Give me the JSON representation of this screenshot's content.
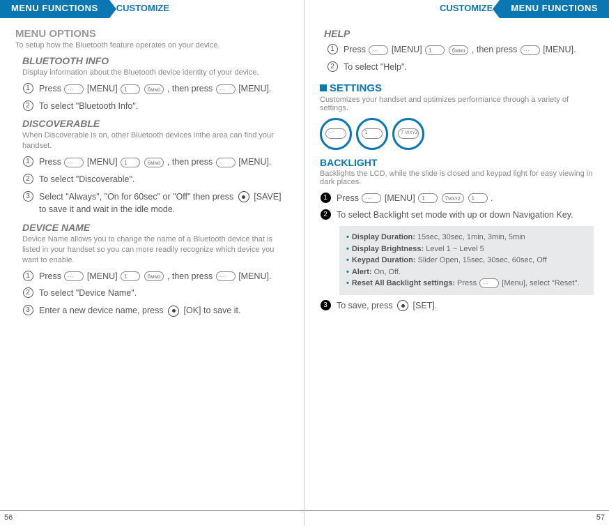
{
  "ribbon": {
    "menu_functions": "MENU FUNCTIONS",
    "customize": "CUSTOMIZE"
  },
  "left": {
    "menu_options": "MENU OPTIONS",
    "menu_options_sub": "To setup how the Bluetooth feature operates on your device.",
    "bt_info": "BLUETOOTH INFO",
    "bt_info_sub": "Display information about the Bluetooth device identity of your device.",
    "bt_s1": "Press [MENU] , then press [MENU].",
    "bt_s1_a": "Press ",
    "bt_s1_b": " [MENU] ",
    "bt_s1_c": " , then press ",
    "bt_s1_d": " [MENU].",
    "bt_s2": "To select \"Bluetooth Info\".",
    "disc": "DISCOVERABLE",
    "disc_sub": "When Discoverable is on, other Bluetooth devices inthe area can find your handset.",
    "disc_s1": "Press [MENU] , then press [MENU].",
    "disc_s2": "To select \"Discoverable\".",
    "disc_s3a": "Select \"Always\", \"On for 60sec\" or \"Off\" then press ",
    "disc_s3b": " [SAVE] to save it and wait in the idle mode.",
    "dn": "DEVICE NAME",
    "dn_sub": "Device Name allows you to change the name of a Bluetooth device that is listed in your handset so you can more readily recognize which device you want to enable.",
    "dn_s1": "Press [MENU] , then press [MENU].",
    "dn_s2": "To select \"Device Name\".",
    "dn_s3a": "Enter a new device name, press ",
    "dn_s3b": " [OK] to save it.",
    "page": "56"
  },
  "right": {
    "help": "HELP",
    "help_s1a": "Press ",
    "help_s1b": " [MENU] ",
    "help_s1c": " , then press ",
    "help_s1d": " [MENU].",
    "help_s2": "To select \"Help\".",
    "settings": "SETTINGS",
    "settings_sub": "Customizes your handset and optimizes performance through a variety of settings.",
    "key1": "···",
    "key2": "1",
    "key3": "7 ᴡxʏz",
    "backlight": "BACKLIGHT",
    "backlight_sub": "Backlights the LCD, while the slide is closed and keypad light for easy viewing in dark places.",
    "bl_s1a": "Press ",
    "bl_s1b": " [MENU] ",
    "bl_s1c": " .",
    "bl_s2": "To select Backlight set mode with up or down Navigation Key.",
    "box": {
      "dd_l": "Display Duration:",
      "dd_v": " 15sec, 30sec, 1min, 3min, 5min",
      "db_l": "Display Brightness:",
      "db_v": " Level 1 ~ Level 5",
      "kd_l": "Keypad Duration:",
      "kd_v": " Slider Open, 15sec, 30sec, 60sec, Off",
      "al_l": "Alert:",
      "al_v": " On, Off.",
      "ra_l": "Reset All Backlight settings:",
      "ra_v": " Press ",
      "ra_v2": " [Menu], select \"Reset\"."
    },
    "bl_s3a": "To save, press ",
    "bl_s3b": " [SET].",
    "page": "57"
  }
}
